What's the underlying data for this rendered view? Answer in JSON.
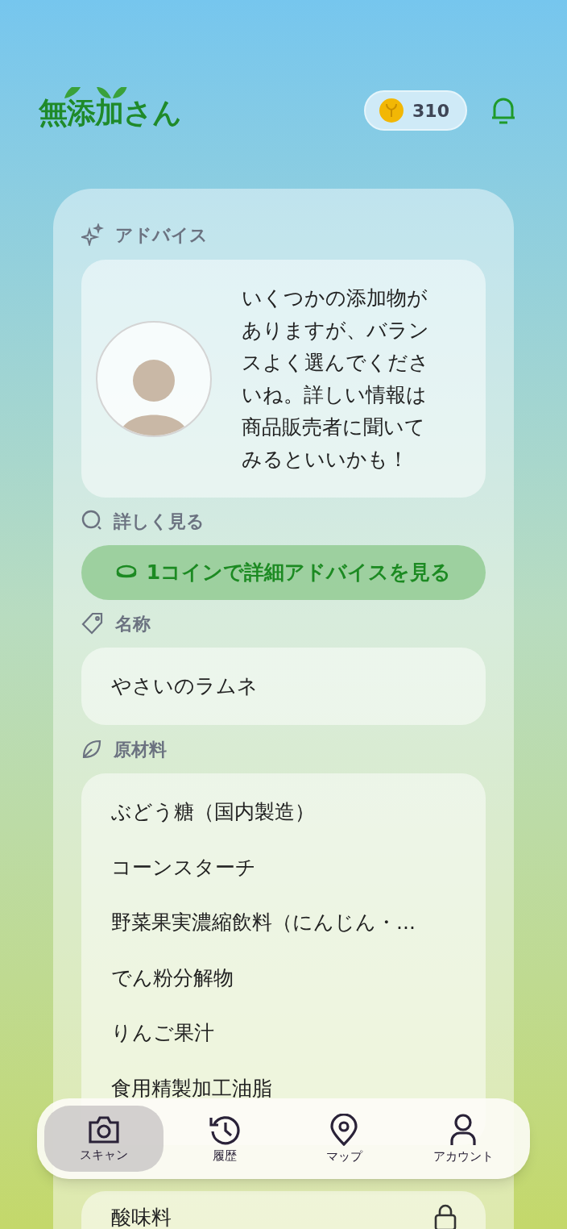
{
  "header": {
    "logo": "無添加さん",
    "coins": "310"
  },
  "advice": {
    "heading": "アドバイス",
    "message": "いくつかの添加物がありますが、バランスよく選んでくださいね。詳しい情報は商品販売者に聞いてみるといいかも！"
  },
  "details": {
    "heading": "詳しく見る",
    "button": "1コインで詳細アドバイスを見る"
  },
  "name": {
    "heading": "名称",
    "value": "やさいのラムネ"
  },
  "ingredients": {
    "heading": "原材料",
    "items": [
      "ぶどう糖（国内製造）",
      "コーンスターチ",
      "野菜果実濃縮飲料（にんじん・...",
      "でん粉分解物",
      "りんご果汁",
      "食用精製加工油脂"
    ]
  },
  "additives": {
    "items": [
      {
        "label": "酸味料",
        "locked": true
      }
    ]
  },
  "nav": [
    {
      "label": "スキャン",
      "kind": "camera",
      "selected": true
    },
    {
      "label": "履歴",
      "kind": "history",
      "selected": false
    },
    {
      "label": "マップ",
      "kind": "map",
      "selected": false
    },
    {
      "label": "アカウント",
      "kind": "account",
      "selected": false
    }
  ]
}
